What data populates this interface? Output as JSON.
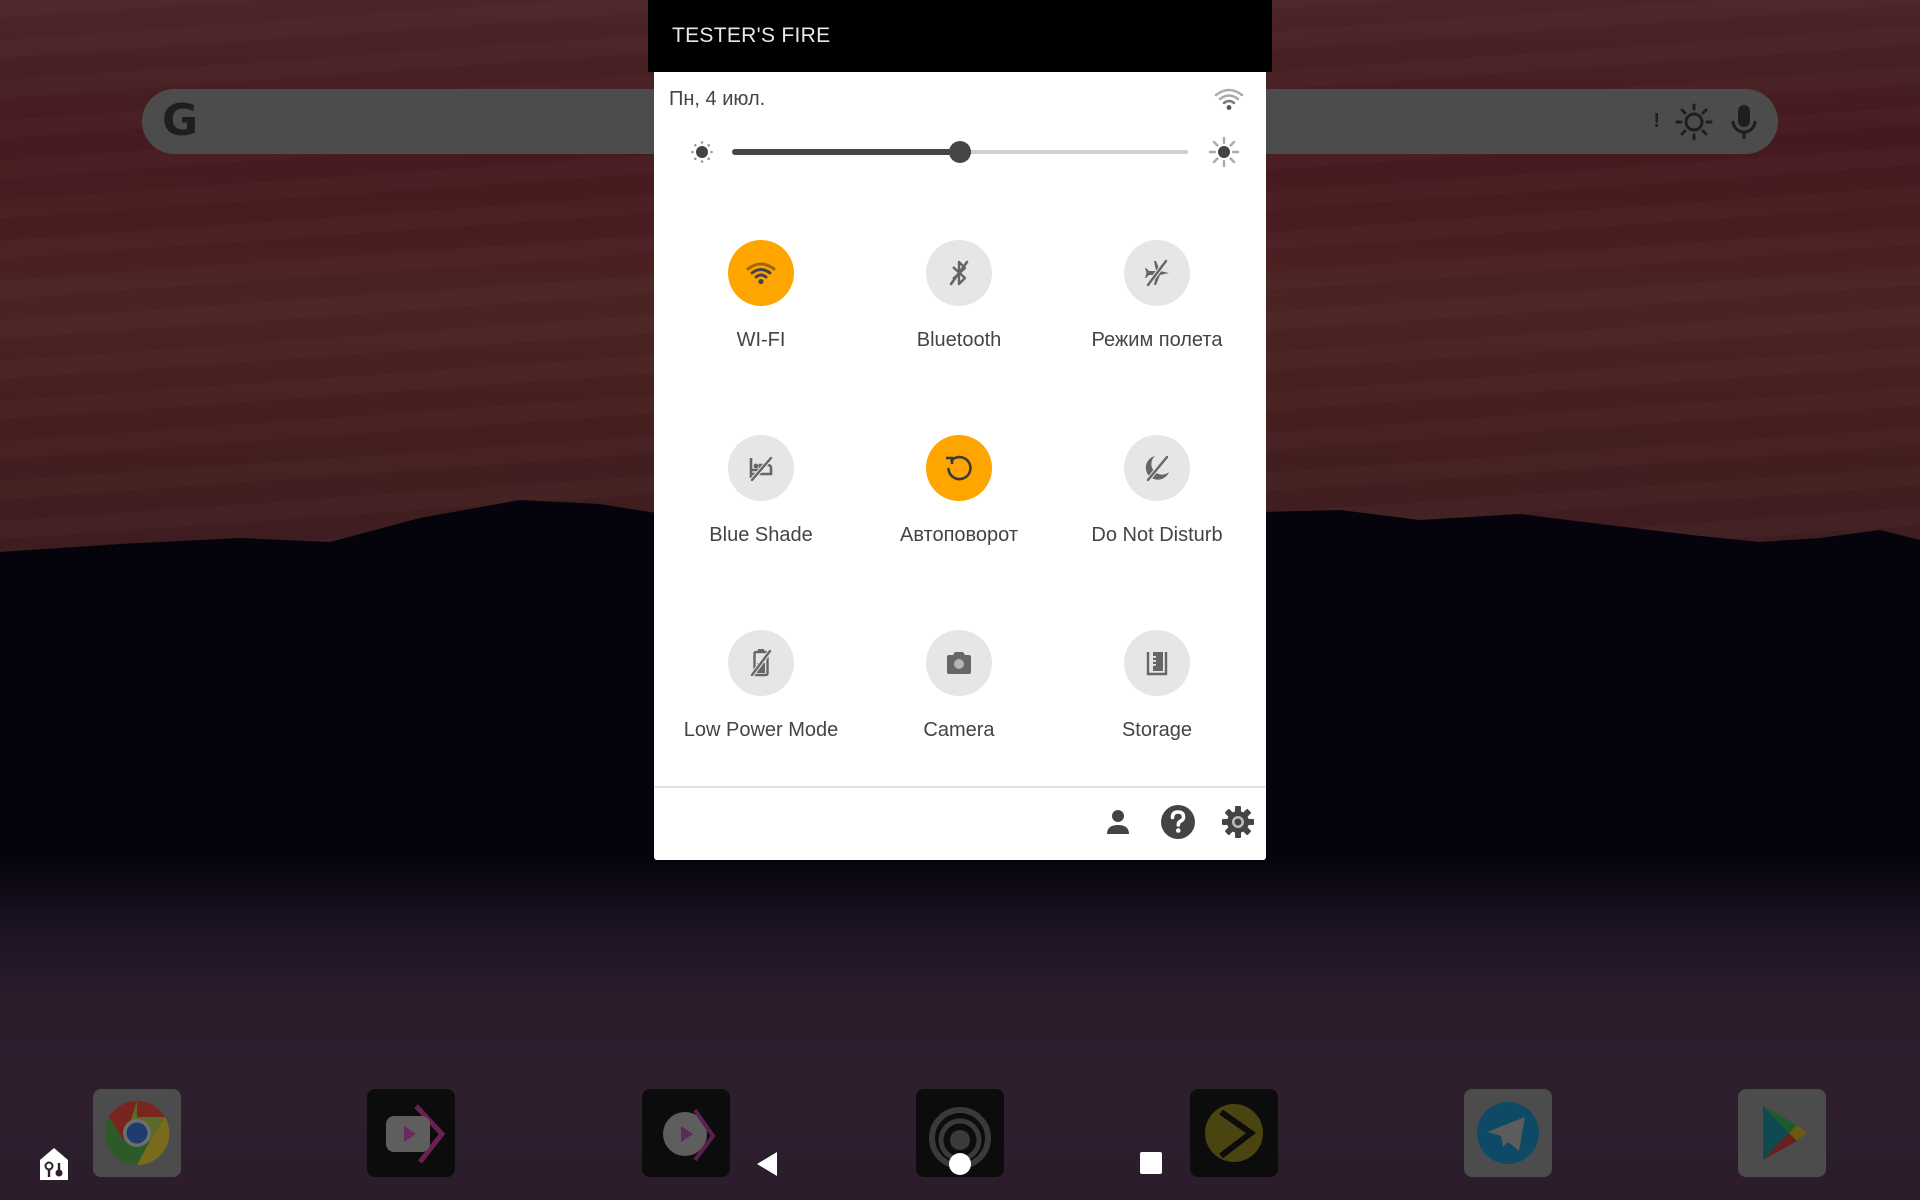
{
  "header": {
    "device_name": "TESTER'S FIRE"
  },
  "status": {
    "date": "Пн, 4 июл.",
    "wifi_icon": "wifi-icon"
  },
  "brightness": {
    "level_percent": 50,
    "low_icon": "brightness-low-icon",
    "high_icon": "brightness-high-icon"
  },
  "tiles": [
    {
      "label": "WI-FI",
      "icon": "wifi-icon",
      "active": true
    },
    {
      "label": "Bluetooth",
      "icon": "bluetooth-off-icon",
      "active": false
    },
    {
      "label": "Режим полета",
      "icon": "airplane-off-icon",
      "active": false
    },
    {
      "label": "Blue Shade",
      "icon": "blue-shade-off-icon",
      "active": false
    },
    {
      "label": "Автоповорот",
      "icon": "auto-rotate-icon",
      "active": true
    },
    {
      "label": "Do Not Disturb",
      "icon": "do-not-disturb-off-icon",
      "active": false
    },
    {
      "label": "Low Power Mode",
      "icon": "battery-saver-off-icon",
      "active": false
    },
    {
      "label": "Camera",
      "icon": "camera-icon",
      "active": false
    },
    {
      "label": "Storage",
      "icon": "storage-icon",
      "active": false
    }
  ],
  "footer": {
    "icons": [
      "user-icon",
      "help-icon",
      "settings-icon"
    ]
  },
  "search": {
    "logo": "G",
    "alert_mark": "!"
  },
  "colors": {
    "active_tile": "#ffa500",
    "inactive_tile": "#e6e6e6",
    "icon_gray": "#666666"
  },
  "dock": {
    "apps": [
      "Chrome",
      "YouTube Vanced",
      "Vanced Music",
      "Podcast app",
      "Plex",
      "Telegram",
      "Google Play"
    ]
  },
  "navigation": [
    "back",
    "home",
    "recents"
  ]
}
